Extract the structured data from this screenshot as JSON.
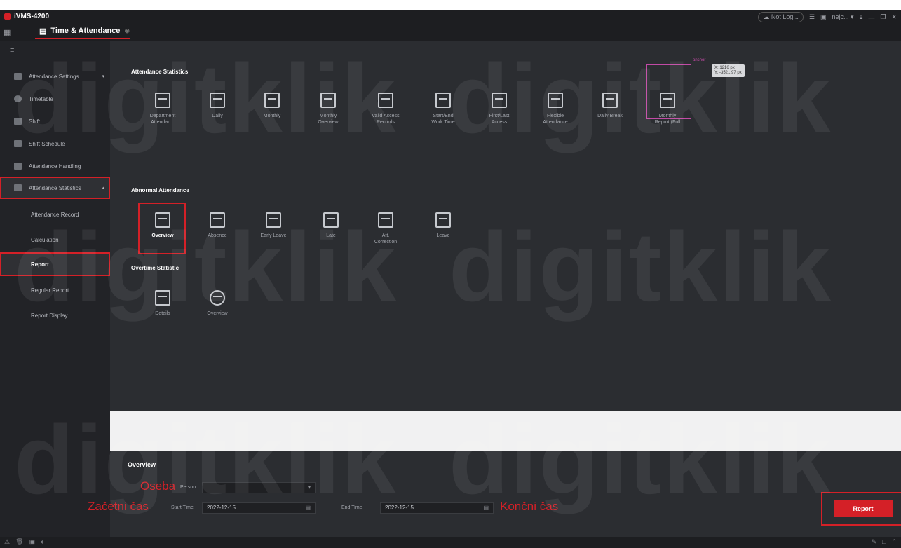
{
  "app": {
    "name": "iVMS-4200",
    "tab_label": "Time & Attendance"
  },
  "titlebar": {
    "cloud_label": "Not Log...",
    "user_label": "nejc..."
  },
  "sidebar": {
    "items": [
      {
        "label": "Attendance Settings",
        "icon": "settings-icon"
      },
      {
        "label": "Timetable",
        "icon": "clock-icon"
      },
      {
        "label": "Shift",
        "icon": "shift-icon"
      },
      {
        "label": "Shift Schedule",
        "icon": "calendar-icon"
      },
      {
        "label": "Attendance Handling",
        "icon": "check-icon"
      },
      {
        "label": "Attendance Statistics",
        "icon": "chart-icon"
      }
    ],
    "subitems": [
      {
        "label": "Attendance Record"
      },
      {
        "label": "Calculation"
      },
      {
        "label": "Report"
      },
      {
        "label": "Regular Report"
      },
      {
        "label": "Report Display"
      }
    ]
  },
  "sections": {
    "attendance_statistics": {
      "title": "Attendance Statistics",
      "tiles": [
        "Department\nAttendan...",
        "Daily",
        "Monthly",
        "Monthly\nOverview",
        "Valid Access\nRecords",
        "Start/End\nWork Time",
        "First/Last\nAccess",
        "Flexible\nAttendance",
        "Daily Break",
        "Monthly\nReport (Full"
      ]
    },
    "abnormal_attendance": {
      "title": "Abnormal Attendance",
      "tiles": [
        "Overview",
        "Absence",
        "Early Leave",
        "Late",
        "Att.\nCorrection",
        "Leave"
      ]
    },
    "overtime_statistic": {
      "title": "Overtime Statistic",
      "tiles": [
        "Details",
        "Overview"
      ]
    }
  },
  "annotation": {
    "anchor": "anchor",
    "x": "X: 1216 px",
    "y": "Y: -3521.97 px"
  },
  "overview_panel": {
    "title": "Overview",
    "person_label": "Person",
    "start_time_label": "Start Time",
    "start_time_value": "2022-12-15",
    "end_time_label": "End Time",
    "end_time_value": "2022-12-15",
    "report_button": "Report"
  },
  "notes": {
    "person": "Oseba",
    "start": "Začetni čas",
    "end": "Končni čas"
  },
  "watermark": "digitklik",
  "colors": {
    "accent": "#d42027",
    "background": "#2b2d31",
    "sidebar": "#222327",
    "highlight": "#c24aa5"
  }
}
